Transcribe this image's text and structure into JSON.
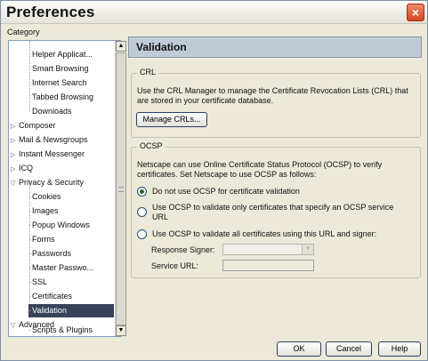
{
  "window": {
    "title": "Preferences",
    "close_glyph": "×"
  },
  "sidebar": {
    "category_label": "Category",
    "items": [
      {
        "label": "Helper Applicat...",
        "level": 1
      },
      {
        "label": "Smart Browsing",
        "level": 1
      },
      {
        "label": "Internet Search",
        "level": 1
      },
      {
        "label": "Tabbed Browsing",
        "level": 1
      },
      {
        "label": "Downloads",
        "level": 1
      },
      {
        "label": "Composer",
        "level": 0,
        "expander": "▷"
      },
      {
        "label": "Mail & Newsgroups",
        "level": 0,
        "expander": "▷"
      },
      {
        "label": "Instant Messenger",
        "level": 0,
        "expander": "▷"
      },
      {
        "label": "ICQ",
        "level": 0,
        "expander": "▷"
      },
      {
        "label": "Privacy & Security",
        "level": 0,
        "expander": "▽"
      },
      {
        "label": "Cookies",
        "level": 1
      },
      {
        "label": "Images",
        "level": 1
      },
      {
        "label": "Popup Windows",
        "level": 1
      },
      {
        "label": "Forms",
        "level": 1
      },
      {
        "label": "Passwords",
        "level": 1
      },
      {
        "label": "Master Passwo...",
        "level": 1
      },
      {
        "label": "SSL",
        "level": 1
      },
      {
        "label": "Certificates",
        "level": 1
      },
      {
        "label": "Validation",
        "level": 1,
        "selected": true
      },
      {
        "label": "Advanced",
        "level": 0,
        "expander": "▽"
      },
      {
        "label": "Scripts & Plugins",
        "level": 1
      }
    ],
    "scroll_up": "▲",
    "scroll_down": "▼"
  },
  "panel": {
    "title": "Validation",
    "crl": {
      "legend": "CRL",
      "description": "Use the CRL Manager to manage the Certificate Revocation Lists (CRL) that are stored in your certificate database.",
      "manage_button": "Manage CRLs..."
    },
    "ocsp": {
      "legend": "OCSP",
      "description": "Netscape can use Online Certificate Status Protocol (OCSP) to verify certificates. Set Netscape to use OCSP as follows:",
      "options": [
        {
          "label": "Do not use OCSP for certificate validation",
          "selected": true
        },
        {
          "label": "Use OCSP to validate only certificates that specify an OCSP service URL",
          "selected": false
        },
        {
          "label": "Use OCSP to validate all certificates using this URL and signer:",
          "selected": false
        }
      ],
      "response_signer_label": "Response Signer:",
      "response_signer_value": "",
      "service_url_label": "Service URL:",
      "service_url_value": ""
    }
  },
  "footer": {
    "ok": "OK",
    "cancel": "Cancel",
    "help": "Help"
  }
}
